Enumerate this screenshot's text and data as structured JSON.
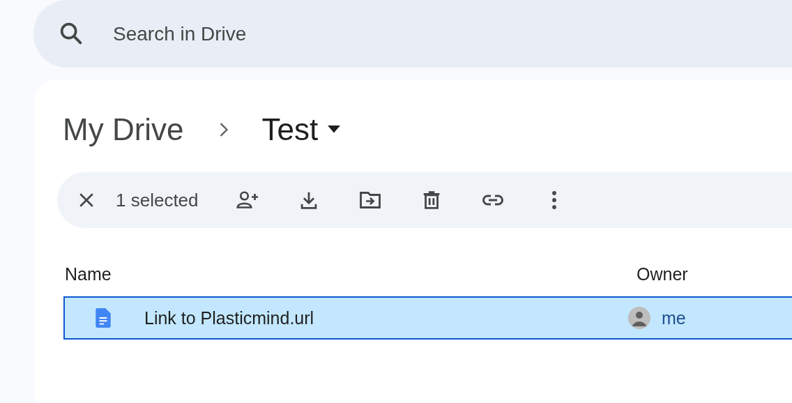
{
  "search": {
    "placeholder": "Search in Drive"
  },
  "breadcrumb": [
    {
      "label": "My Drive",
      "current": false
    },
    {
      "label": "Test",
      "current": true
    }
  ],
  "selection_bar": {
    "count_text": "1 selected"
  },
  "table": {
    "columns": [
      "Name",
      "Owner"
    ],
    "rows": [
      {
        "name": "Link to Plasticmind.url",
        "owner": "me",
        "selected": true
      }
    ]
  }
}
